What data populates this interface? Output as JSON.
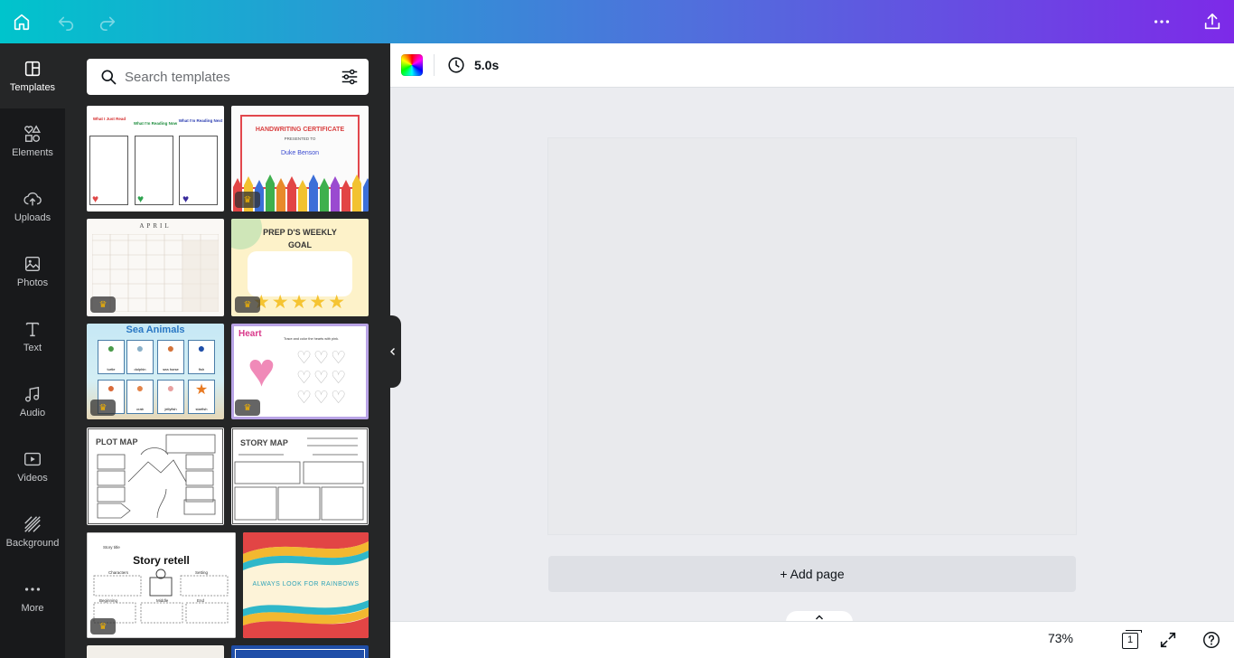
{
  "topbar": {
    "home_icon": "home-icon",
    "undo_icon": "undo-icon",
    "redo_icon": "redo-icon",
    "more_icon": "more-horizontal-icon",
    "share_icon": "share-upload-icon"
  },
  "rail": {
    "items": [
      {
        "label": "Templates",
        "icon": "templates-icon"
      },
      {
        "label": "Elements",
        "icon": "elements-icon"
      },
      {
        "label": "Uploads",
        "icon": "uploads-icon"
      },
      {
        "label": "Photos",
        "icon": "photos-icon"
      },
      {
        "label": "Text",
        "icon": "text-icon"
      },
      {
        "label": "Audio",
        "icon": "audio-icon"
      },
      {
        "label": "Videos",
        "icon": "videos-icon"
      },
      {
        "label": "Background",
        "icon": "background-icon"
      },
      {
        "label": "More",
        "icon": "more-icon"
      }
    ]
  },
  "panel": {
    "search_placeholder": "Search templates",
    "templates": [
      {
        "id": "reading-log",
        "headers": [
          "What I Just Read",
          "What I'm Reading Now",
          "What I'm Reading Next"
        ],
        "premium": false
      },
      {
        "id": "handwriting-certificate",
        "title": "HANDWRITING CERTIFICATE",
        "subtitle": "PRESENTED TO",
        "name": "Duke Benson",
        "premium": true
      },
      {
        "id": "april-calendar",
        "title": "APRIL",
        "premium": true
      },
      {
        "id": "weekly-goal",
        "title": "PREP D'S WEEKLY GOAL",
        "premium": true
      },
      {
        "id": "sea-animals",
        "title": "Sea Animals",
        "animals": [
          "turtle",
          "dolphin",
          "sea horse",
          "fish",
          "crab",
          "crab",
          "jellyfish",
          "starfish"
        ],
        "premium": true
      },
      {
        "id": "heart-worksheet",
        "title": "Heart",
        "instruction": "Trace and color the hearts with pink.",
        "premium": true
      },
      {
        "id": "plot-map",
        "title": "PLOT MAP",
        "premium": false
      },
      {
        "id": "story-map",
        "title": "STORY MAP",
        "premium": false
      },
      {
        "id": "story-retell",
        "title": "Story retell",
        "labels": [
          "Story title",
          "Characters",
          "Setting",
          "Beginning",
          "Middle",
          "End"
        ],
        "premium": true
      },
      {
        "id": "rainbows",
        "title": "ALWAYS LOOK FOR RAINBOWS",
        "premium": false
      }
    ]
  },
  "toolbar": {
    "color_icon": "color-picker-icon",
    "timer_icon": "clock-icon",
    "duration": "5.0s"
  },
  "canvas": {
    "add_page_label": "+ Add page"
  },
  "footer": {
    "zoom": "73%",
    "page_count": "1",
    "expand_icon": "chevron-up-icon",
    "fullscreen_icon": "fullscreen-icon",
    "help_icon": "help-icon"
  }
}
